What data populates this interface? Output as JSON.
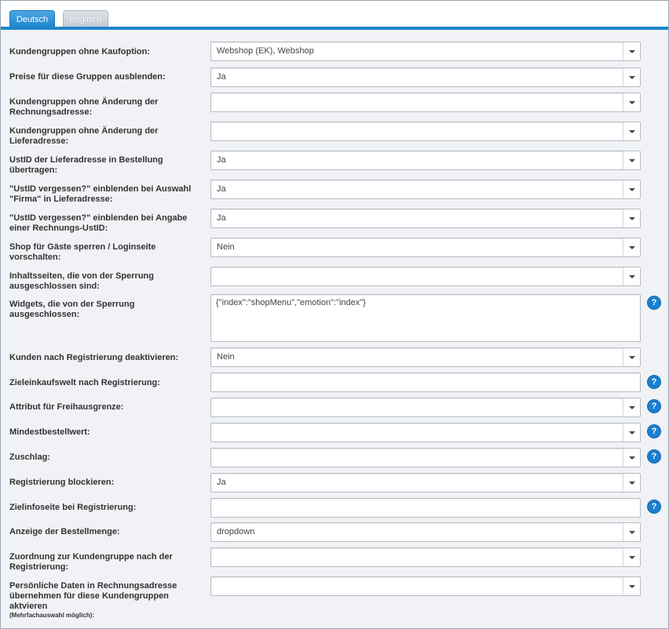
{
  "tabs": [
    {
      "label": "Deutsch",
      "active": true
    },
    {
      "label": "Englisch",
      "active": false
    }
  ],
  "rows": [
    {
      "label": "Kundengruppen ohne Kaufoption:",
      "value": "Webshop (EK), Webshop"
    },
    {
      "label": "Preise für diese Gruppen ausblenden:",
      "value": "Ja"
    },
    {
      "label": "Kundengruppen ohne Änderung der Rechnungsadresse:",
      "value": ""
    },
    {
      "label": "Kundengruppen ohne Änderung der Lieferadresse:",
      "value": ""
    },
    {
      "label": "UstID der Lieferadresse in Bestellung übertragen:",
      "value": "Ja"
    },
    {
      "label": "\"UstID vergessen?\" einblenden bei Auswahl \"Firma\" in Lieferadresse:",
      "value": "Ja"
    },
    {
      "label": "\"UstID vergessen?\" einblenden bei Angabe einer Rechnungs-UstID:",
      "value": "Ja"
    },
    {
      "label": "Shop für Gäste sperren / Loginseite vorschalten:",
      "value": "Nein"
    },
    {
      "label": "Inhaltsseiten, die von der Sperrung ausgeschlossen sind:",
      "value": ""
    },
    {
      "label": "Widgets, die von der Sperrung ausgeschlossen:",
      "value": "{\"index\":\"shopMenu\",\"emotion\":\"index\"}"
    },
    {
      "label": "Kunden nach Registrierung deaktivieren:",
      "value": "Nein"
    },
    {
      "label": "Zieleinkaufswelt nach Registrierung:",
      "value": ""
    },
    {
      "label": "Attribut für Freihausgrenze:",
      "value": ""
    },
    {
      "label": "Mindestbestellwert:",
      "value": ""
    },
    {
      "label": "Zuschlag:",
      "value": ""
    },
    {
      "label": "Registrierung blockieren:",
      "value": "Ja"
    },
    {
      "label": "Zielinfoseite bei Registrierung:",
      "value": ""
    },
    {
      "label": "Anzeige der Bestellmenge:",
      "value": "dropdown"
    },
    {
      "label": "Zuordnung zur Kundengruppe nach der Registrierung:",
      "value": ""
    },
    {
      "label": "Persönliche Daten in Rechnungsadresse übernehmen für diese Kundengruppen aktvieren",
      "sublabel": "(Mehrfachauswahl möglich):",
      "value": ""
    }
  ],
  "help_icon": "question-icon",
  "help_glyph": "?",
  "colors": {
    "accent": "#1f86cc",
    "help": "#1a7fd0"
  }
}
